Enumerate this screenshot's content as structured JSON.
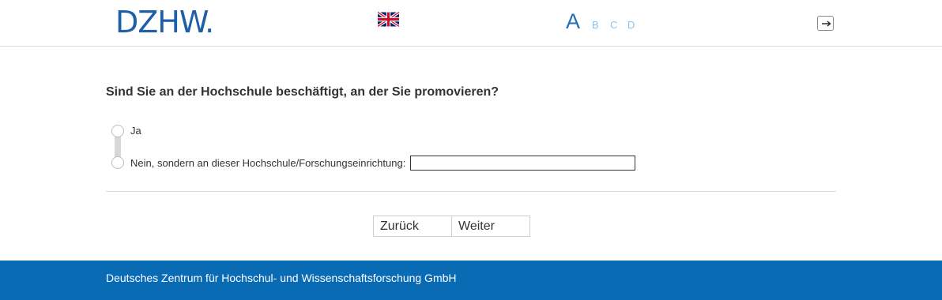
{
  "header": {
    "logo_text": "DZHW.",
    "language_flag": "uk-flag-icon",
    "sections": {
      "current": "A",
      "others": [
        "B",
        "C",
        "D"
      ]
    },
    "exit_icon": "exit-icon"
  },
  "question": {
    "text": "Sind Sie an der Hochschule beschäftigt, an der Sie promovieren?",
    "options": [
      {
        "label": "Ja"
      },
      {
        "label": "Nein, sondern an dieser Hochschule/Forschungseinrichtung:"
      }
    ],
    "other_input_value": ""
  },
  "navigation": {
    "back_label": "Zurück",
    "next_label": "Weiter"
  },
  "footer": {
    "text": "Deutsches Zentrum für Hochschul- und Wissenschaftsforschung GmbH"
  },
  "colors": {
    "brand_blue": "#1f5fa8",
    "footer_blue": "#0a6bb5",
    "section_inactive": "#8ec3ea"
  }
}
